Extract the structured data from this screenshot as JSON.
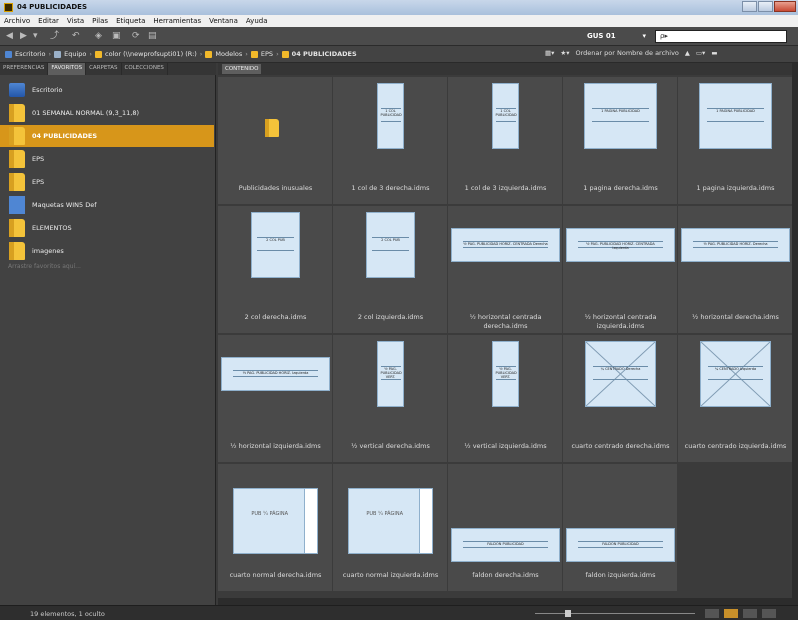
{
  "window": {
    "title": "04 PUBLICIDADES"
  },
  "menu": [
    "Archivo",
    "Editar",
    "Vista",
    "Pilas",
    "Etiqueta",
    "Herramientas",
    "Ventana",
    "Ayuda"
  ],
  "toolbar": {
    "workspace": "GUS 01",
    "search_placeholder": "ρ▸"
  },
  "breadcrumb": [
    "Escritorio",
    "Equipo",
    "color (\\\\newprofsupti01) (R:)",
    "Modelos",
    "EPS",
    "04 PUBLICIDADES"
  ],
  "sort": {
    "label": "Ordenar por Nombre de archivo"
  },
  "left_tabs": [
    "PREFERENCIAS",
    "FAVORITOS",
    "CARPETAS",
    "COLECCIONES"
  ],
  "favorites": [
    {
      "label": "Escritorio",
      "icon": "desktop-icon"
    },
    {
      "label": "01 SEMANAL NORMAL (9,3_11,8)",
      "icon": "folder-icon"
    },
    {
      "label": "04 PUBLICIDADES",
      "icon": "folder-icon",
      "selected": true
    },
    {
      "label": "EPS",
      "icon": "folder-icon"
    },
    {
      "label": "EPS",
      "icon": "folder-icon"
    },
    {
      "label": "Maquetas WIN5 Def",
      "icon": "network-folder-icon"
    },
    {
      "label": "ELEMENTOS",
      "icon": "folder-icon"
    },
    {
      "label": "imagenes",
      "icon": "folder-icon"
    }
  ],
  "drag_hint": "Arrastre favoritos aquí...",
  "content_tab": "CONTENIDO",
  "files": [
    {
      "name": "Publicidades inusuales",
      "kind": "folder"
    },
    {
      "name": "1 col de 3 derecha.idms",
      "kind": "tallnarrow",
      "text": "1 COL PUBLICIDAD"
    },
    {
      "name": "1 col de 3 izquierda.idms",
      "kind": "tallnarrow",
      "text": "1 COL PUBLICIDAD"
    },
    {
      "name": "1 pagina derecha.idms",
      "kind": "page",
      "text": "1 PAGINA PUBLICIDAD"
    },
    {
      "name": "1 pagina izquierda.idms",
      "kind": "page",
      "text": "1 PAGINA PUBLICIDAD"
    },
    {
      "name": "2 col derecha.idms",
      "kind": "twocol",
      "text": "2 COL PUB"
    },
    {
      "name": "2 col izquierda.idms",
      "kind": "twocol",
      "text": "2 COL PUB"
    },
    {
      "name": "½ horizontal centrada derecha.idms",
      "kind": "wide",
      "text": "½ PAG. PUBLICIDAD HORIZ. CENTRADA Derecha"
    },
    {
      "name": "½ horizontal centrada izquierda.idms",
      "kind": "wide",
      "text": "½ PAG. PUBLICIDAD HORIZ. CENTRADA Izquierda"
    },
    {
      "name": "½ horizontal derecha.idms",
      "kind": "wide",
      "text": "½ PAG. PUBLICIDAD HORIZ. Derecha"
    },
    {
      "name": "½ horizontal izquierda.idms",
      "kind": "wide",
      "text": "½ PAG. PUBLICIDAD HORIZ. Izquierda"
    },
    {
      "name": "½ vertical derecha.idms",
      "kind": "tallnarrow",
      "text": "½ PAG. PUBLICIDAD VERT."
    },
    {
      "name": "½ vertical izquierda.idms",
      "kind": "tallnarrow",
      "text": "½ PAG. PUBLICIDAD VERT."
    },
    {
      "name": "cuarto centrado derecha.idms",
      "kind": "cross",
      "text": "¼ CENTRADO Derecha"
    },
    {
      "name": "cuarto centrado izquierda.idms",
      "kind": "cross",
      "text": "¼ CENTRADO Izquierda"
    },
    {
      "name": "cuarto normal derecha.idms",
      "kind": "quarter",
      "text": "PUB ¼ PÁGINA"
    },
    {
      "name": "cuarto normal izquierda.idms",
      "kind": "quarter",
      "text": "PUB ¼ PÁGINA"
    },
    {
      "name": "faldon derecha.idms",
      "kind": "strip",
      "text": "FALDÓN PUBLICIDAD"
    },
    {
      "name": "faldon izquierda.idms",
      "kind": "strip",
      "text": "FALDÓN PUBLICIDAD"
    }
  ],
  "status": {
    "text": "19 elementos, 1 oculto"
  },
  "colors": {
    "selection": "#d7961a",
    "thumb": "#d6e7f5",
    "panel": "#424242"
  }
}
